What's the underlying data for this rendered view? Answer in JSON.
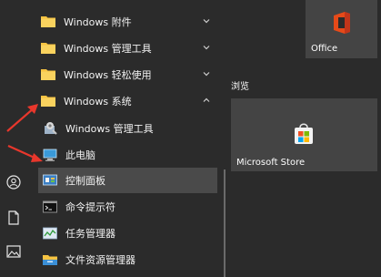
{
  "start_menu": {
    "app_list": [
      {
        "label": "Windows 附件",
        "type": "folder",
        "expanded": false
      },
      {
        "label": "Windows 管理工具",
        "type": "folder",
        "expanded": false
      },
      {
        "label": "Windows 轻松使用",
        "type": "folder",
        "expanded": false
      },
      {
        "label": "Windows 系统",
        "type": "folder",
        "expanded": true
      },
      {
        "label": "Windows 管理工具",
        "type": "app",
        "icon": "admin-tools-icon"
      },
      {
        "label": "此电脑",
        "type": "app",
        "icon": "this-pc-icon"
      },
      {
        "label": "控制面板",
        "type": "app",
        "icon": "control-panel-icon",
        "selected": true
      },
      {
        "label": "命令提示符",
        "type": "app",
        "icon": "command-prompt-icon"
      },
      {
        "label": "任务管理器",
        "type": "app",
        "icon": "task-manager-icon"
      },
      {
        "label": "文件资源管理器",
        "type": "app",
        "icon": "file-explorer-icon"
      }
    ],
    "tiles": {
      "office_label": "Office",
      "group_label": "浏览",
      "store_label": "Microsoft Store"
    },
    "rail_icons": [
      "user-icon",
      "document-icon",
      "pictures-icon"
    ],
    "colors": {
      "background": "#2b2b2b",
      "tile": "#444444",
      "selected_row": "#4a4a4a",
      "folder": "#f6c342",
      "annotation_arrow": "#e8372c"
    }
  }
}
